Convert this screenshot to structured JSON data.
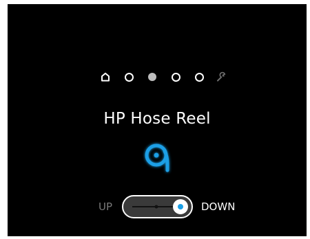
{
  "pages": {
    "items": [
      {
        "type": "home",
        "icon": "home-icon"
      },
      {
        "type": "dot"
      },
      {
        "type": "dot",
        "active": true
      },
      {
        "type": "dot"
      },
      {
        "type": "dot"
      },
      {
        "type": "settings",
        "icon": "wrench-icon"
      }
    ],
    "active_index": 2
  },
  "title": "HP Hose Reel",
  "icon": "hose-reel-icon",
  "accent_color": "#1a9fe6",
  "toggle": {
    "up_label": "UP",
    "down_label": "DOWN",
    "state": "DOWN"
  }
}
